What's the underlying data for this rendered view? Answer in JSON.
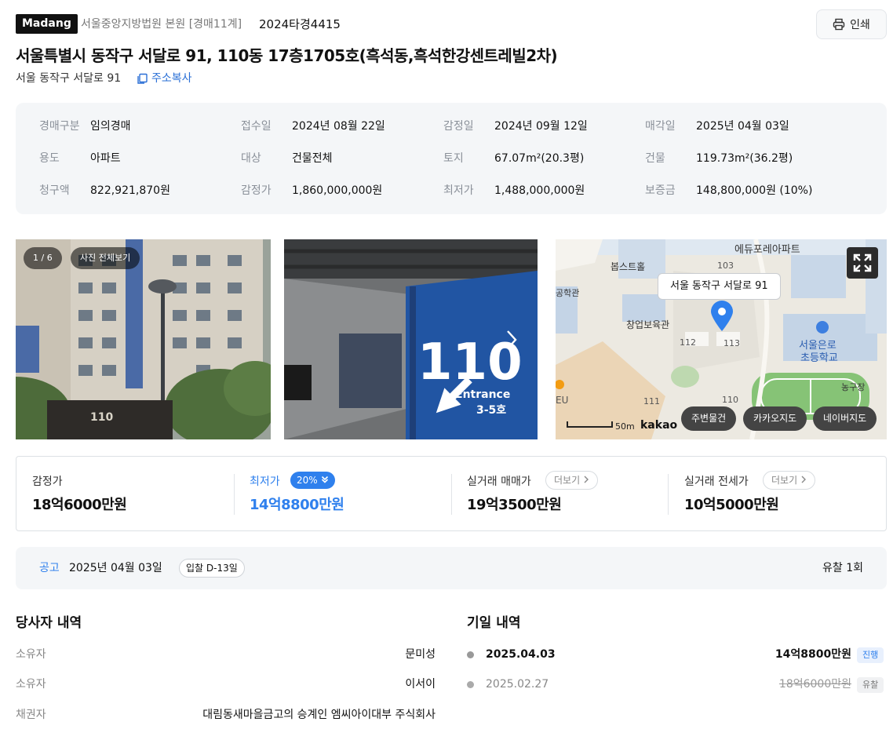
{
  "header": {
    "logo": "Madang",
    "court": "서울중앙지방법원 본원 [경매11계]",
    "case_no": "2024타경4415",
    "print_label": "인쇄",
    "title": "서울특별시 동작구 서달로 91, 110동 17층1705호(흑석동,흑석한강센트레빌2차)",
    "short_address": "서울 동작구 서달로 91",
    "copy_label": "주소복사"
  },
  "info": [
    {
      "label": "경매구분",
      "value": "임의경매"
    },
    {
      "label": "접수일",
      "value": "2024년 08월 22일"
    },
    {
      "label": "감정일",
      "value": "2024년 09월 12일"
    },
    {
      "label": "매각일",
      "value": "2025년 04월 03일"
    },
    {
      "label": "용도",
      "value": "아파트"
    },
    {
      "label": "대상",
      "value": "건물전체"
    },
    {
      "label": "토지",
      "value": "67.07m²(20.3평)"
    },
    {
      "label": "건물",
      "value": "119.73m²(36.2평)"
    },
    {
      "label": "청구액",
      "value": "822,921,870원"
    },
    {
      "label": "감정가",
      "value": "1,860,000,000원"
    },
    {
      "label": "최저가",
      "value": "1,488,000,000원"
    },
    {
      "label": "보증금",
      "value": "148,800,000원 (10%)"
    }
  ],
  "gallery": {
    "counter": "1 / 6",
    "view_all": "사진 전체보기",
    "sign_number": "110",
    "sign_entrance": "Entrance",
    "sign_floors": "3-5호",
    "building_sign": "110"
  },
  "map": {
    "address_bubble": "서울 동작구 서달로 91",
    "labels": [
      "에듀포레아파트",
      "봅스트홀",
      "103",
      "공학관",
      "창업보육관",
      "112",
      "113",
      "서울은로",
      "초등학교",
      "농구장",
      "111",
      "110",
      "EU"
    ],
    "scale": "50m",
    "brand": "kakao",
    "buttons": [
      "주변물건",
      "카카오지도",
      "네이버지도"
    ]
  },
  "prices": {
    "appraisal_label": "감정가",
    "appraisal_value": "18억6000만원",
    "min_label": "최저가",
    "min_pct": "20%",
    "min_value": "14억8800만원",
    "trade_label": "실거래 매매가",
    "trade_more": "더보기",
    "trade_value": "19억3500만원",
    "lease_label": "실거래 전세가",
    "lease_more": "더보기",
    "lease_value": "10억5000만원"
  },
  "notice": {
    "label": "공고",
    "date": "2025년 04월 03일",
    "dday": "입찰 D-13일",
    "fail_count": "유찰 1회"
  },
  "parties": {
    "title": "당사자 내역",
    "rows": [
      {
        "role": "소유자",
        "name": "문미성"
      },
      {
        "role": "소유자",
        "name": "이서이"
      },
      {
        "role": "채권자",
        "name": "대림동새마을금고의 승계인 엠씨아이대부 주식회사"
      }
    ]
  },
  "schedule": {
    "title": "기일 내역",
    "rows": [
      {
        "date": "2025.04.03",
        "price": "14억8800만원",
        "status": "진행"
      },
      {
        "date": "2025.02.27",
        "price": "18억6000만원",
        "status": "유찰"
      }
    ]
  },
  "colors": {
    "accent": "#2f80ed",
    "pin": "#2f80ed"
  }
}
